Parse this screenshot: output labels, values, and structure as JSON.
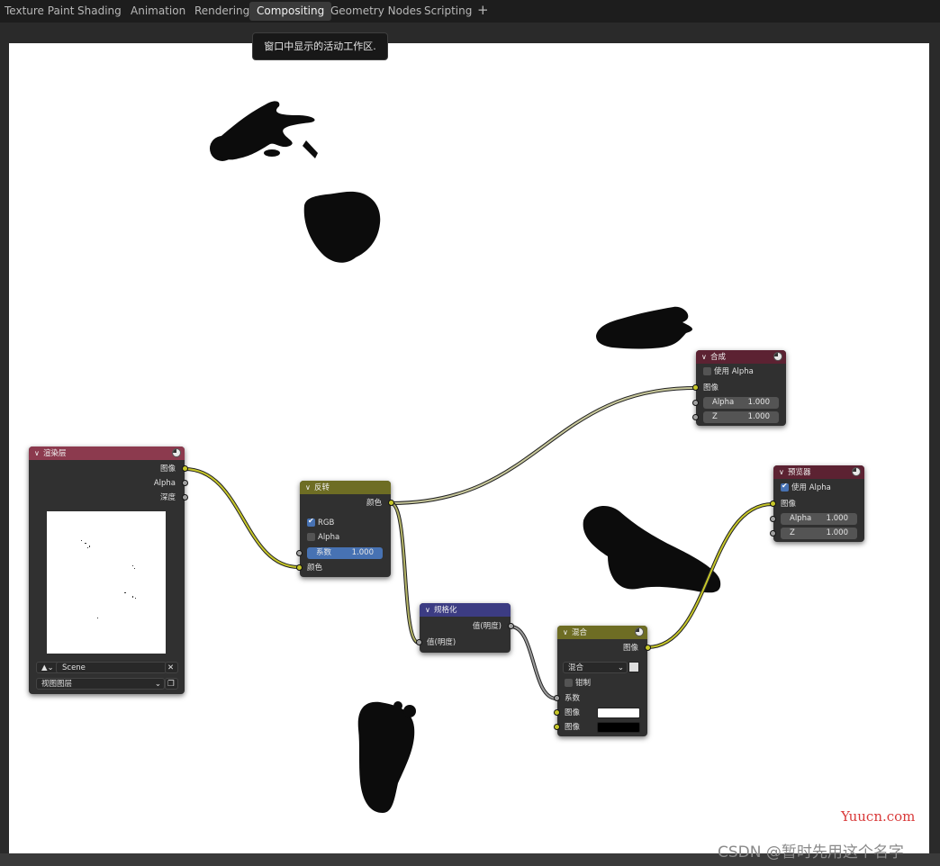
{
  "tabs": [
    {
      "label": "Texture Paint",
      "active": false
    },
    {
      "label": "Shading",
      "active": false
    },
    {
      "label": "Animation",
      "active": false
    },
    {
      "label": "Rendering",
      "active": false
    },
    {
      "label": "Compositing",
      "active": true
    },
    {
      "label": "Geometry Nodes",
      "active": false
    },
    {
      "label": "Scripting",
      "active": false
    }
  ],
  "add_tab_symbol": "+",
  "tooltip": "窗口中显示的活动工作区.",
  "colors": {
    "header_render_layers": "#8c3a4e",
    "header_invert": "#6e6d24",
    "header_normalize": "#3c3c83",
    "header_mix": "#6e6d24",
    "header_composite": "#5c2232",
    "header_viewer": "#5c2232",
    "socket_color": "#c7c729",
    "socket_value": "#a1a1a1",
    "accent_blue": "#4772b3"
  },
  "nodes": {
    "render_layers": {
      "title": "渲染层",
      "outputs": [
        "图像",
        "Alpha",
        "深度"
      ],
      "scene_icon": "scene-icon",
      "scene": "Scene",
      "view_layer": "视图图层"
    },
    "invert": {
      "title": "反转",
      "output": "颜色",
      "rgb_label": "RGB",
      "rgb_checked": true,
      "alpha_label": "Alpha",
      "alpha_checked": false,
      "fac_label": "系数",
      "fac_value": "1.000",
      "input": "颜色"
    },
    "normalize": {
      "title": "规格化",
      "output": "值(明度)",
      "input": "值(明度)"
    },
    "mix": {
      "title": "混合",
      "output": "图像",
      "blend_mode": "混合",
      "clamp_label": "钳制",
      "clamp_checked": false,
      "fac_label": "系数",
      "image1_label": "图像",
      "image1_color": "#ffffff",
      "image2_label": "图像",
      "image2_color": "#000000"
    },
    "composite": {
      "title": "合成",
      "use_alpha_label": "使用 Alpha",
      "use_alpha_checked": false,
      "image_label": "图像",
      "alpha_label": "Alpha",
      "alpha_value": "1.000",
      "z_label": "Z",
      "z_value": "1.000"
    },
    "viewer": {
      "title": "预览器",
      "use_alpha_label": "使用 Alpha",
      "use_alpha_checked": true,
      "image_label": "图像",
      "alpha_label": "Alpha",
      "alpha_value": "1.000",
      "z_label": "Z",
      "z_value": "1.000"
    }
  },
  "watermark": {
    "site": "Yuucn.com",
    "csdn": "CSDN @暂时先用这个名字"
  }
}
